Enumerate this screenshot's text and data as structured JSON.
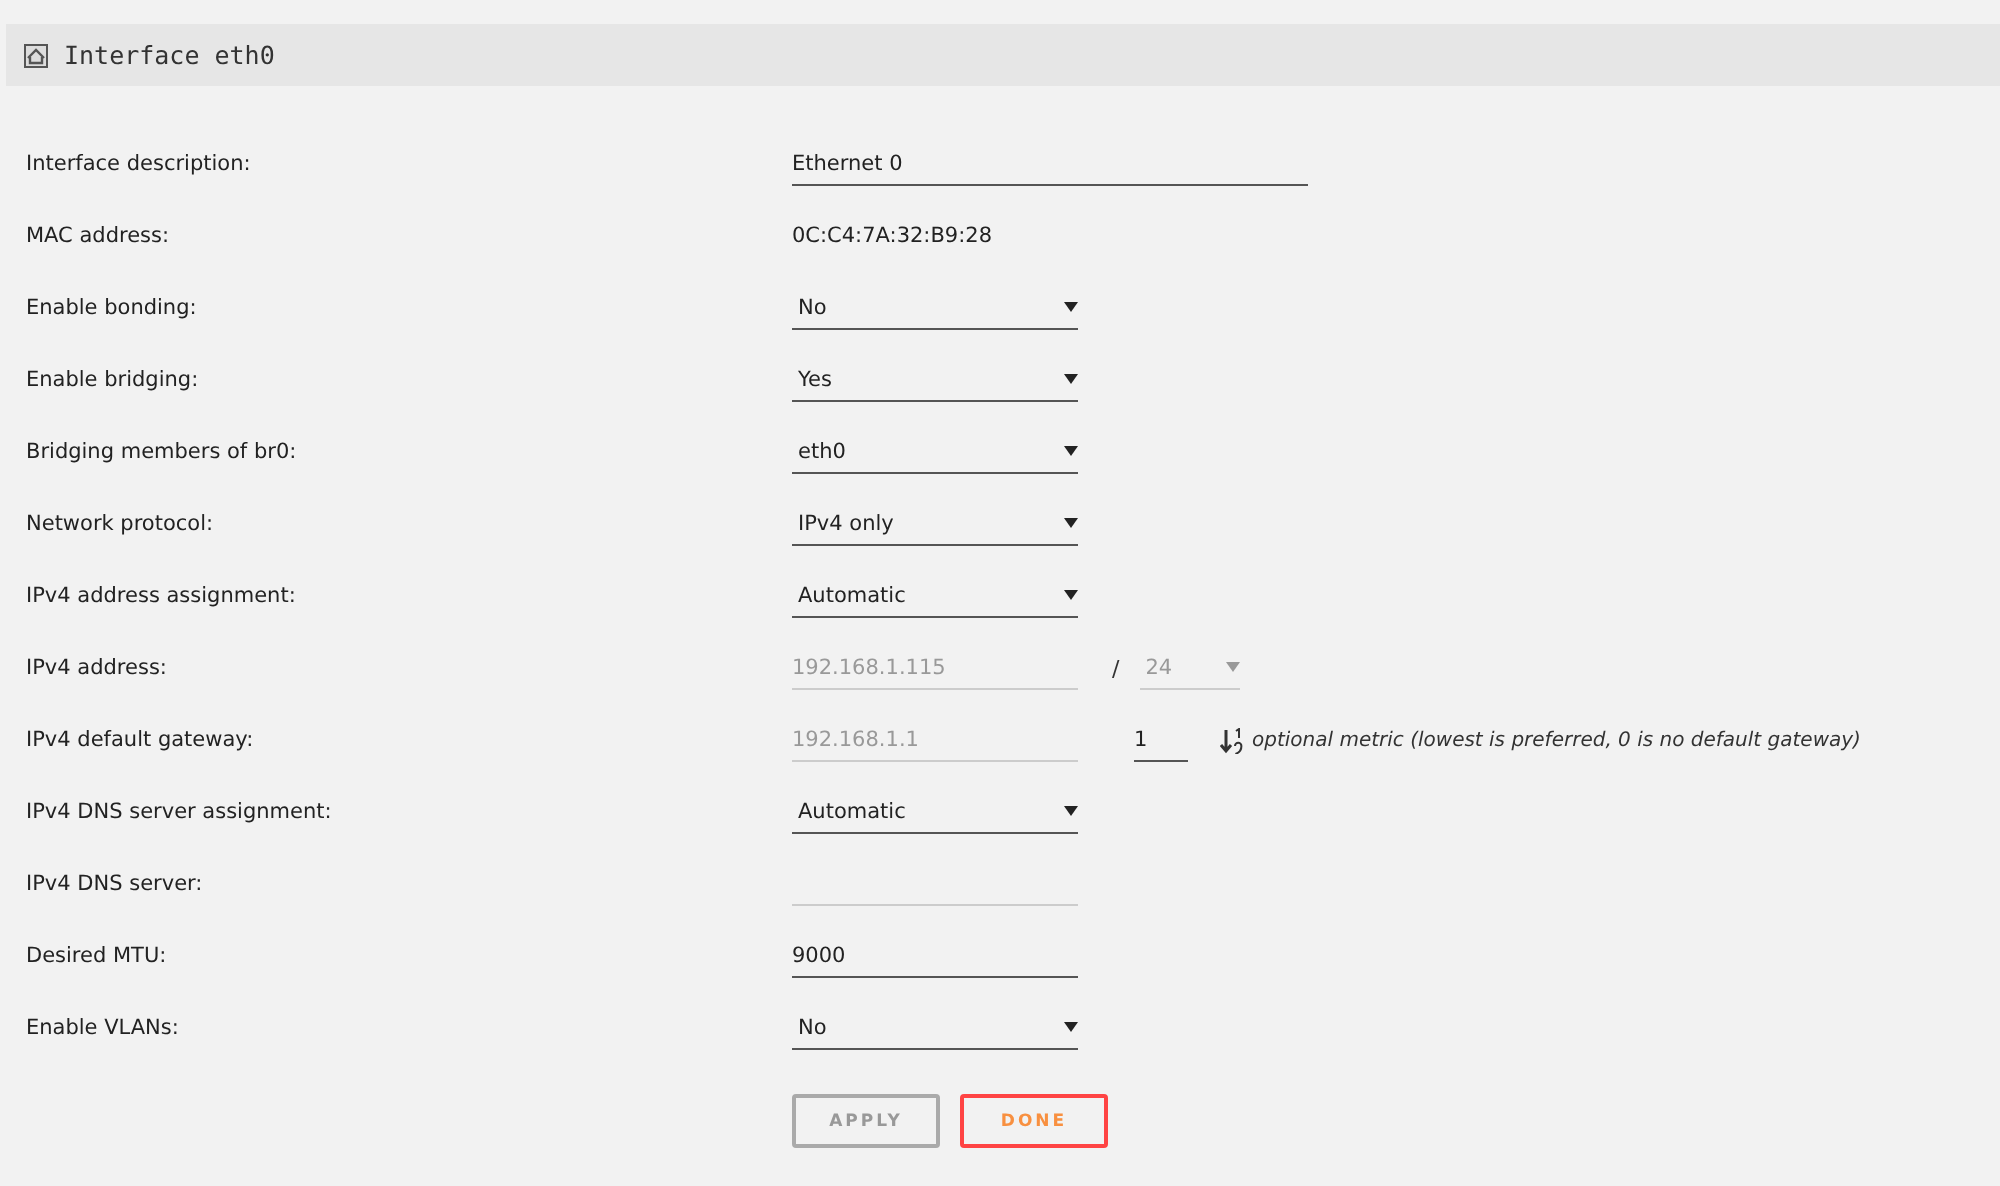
{
  "panel": {
    "title": "Interface eth0"
  },
  "rows": [
    {
      "label": "Interface description:",
      "kind": "input",
      "wide": true,
      "value": "Ethernet 0",
      "disabled": false
    },
    {
      "label": "MAC address:",
      "kind": "static",
      "value": "0C:C4:7A:32:B9:28"
    },
    {
      "label": "Enable bonding:",
      "kind": "select",
      "value": "No",
      "disabled": false
    },
    {
      "label": "Enable bridging:",
      "kind": "select",
      "value": "Yes",
      "disabled": false
    },
    {
      "label": "Bridging members of br0:",
      "kind": "select",
      "value": "eth0",
      "disabled": false
    },
    {
      "label": "Network protocol:",
      "kind": "select",
      "value": "IPv4 only",
      "disabled": false
    },
    {
      "label": "IPv4 address assignment:",
      "kind": "select",
      "value": "Automatic",
      "disabled": false
    },
    {
      "label": "IPv4 address:",
      "kind": "ip-prefix",
      "value": "192.168.1.115",
      "disabled": true,
      "separator": "/",
      "prefix": "24"
    },
    {
      "label": "IPv4 default gateway:",
      "kind": "ip-metric",
      "value": "192.168.1.1",
      "disabled": true,
      "metric": "1",
      "note": "optional metric (lowest is preferred, 0 is no default gateway)"
    },
    {
      "label": "IPv4 DNS server assignment:",
      "kind": "select",
      "value": "Automatic",
      "disabled": false
    },
    {
      "label": "IPv4 DNS server:",
      "kind": "input",
      "wide": false,
      "disabled": true
    },
    {
      "label": "Desired MTU:",
      "kind": "input",
      "wide": false,
      "value": "9000",
      "disabled": false
    },
    {
      "label": "Enable VLANs:",
      "kind": "select",
      "value": "No",
      "disabled": false
    }
  ],
  "buttons": [
    {
      "label": "APPLY",
      "disabled": true
    },
    {
      "label": "DONE",
      "disabled": false
    }
  ]
}
